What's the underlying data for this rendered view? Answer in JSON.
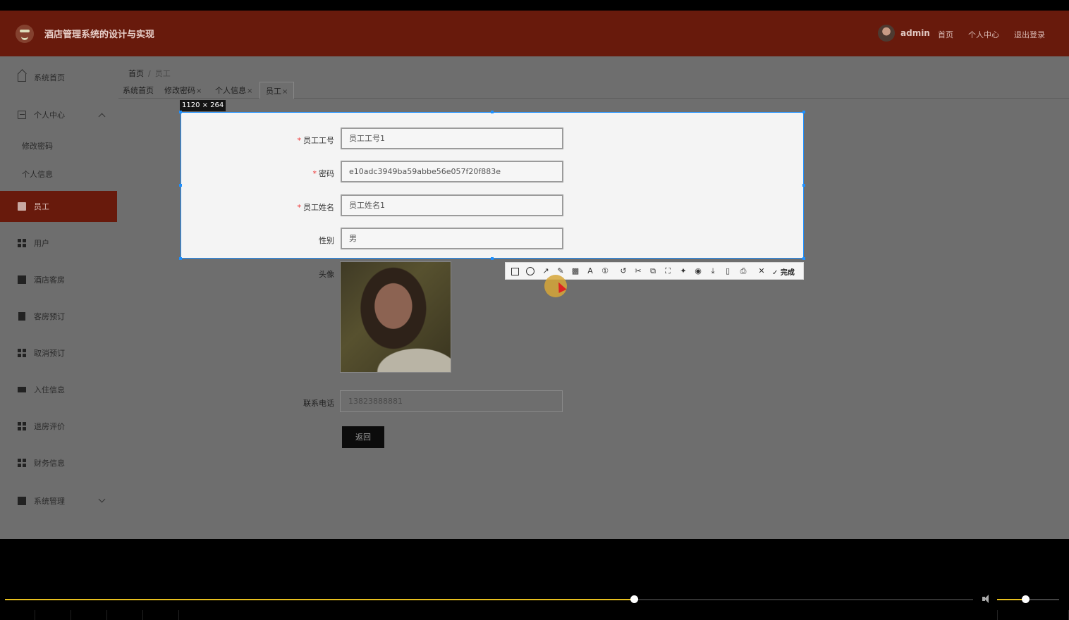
{
  "header": {
    "app_title": "酒店管理系统的设计与实现",
    "username": "admin",
    "links": [
      "首页",
      "个人中心",
      "退出登录"
    ]
  },
  "sidebar": {
    "items": [
      {
        "label": "系统首页",
        "icon": "home-icon"
      },
      {
        "label": "个人中心",
        "icon": "profile-card-icon",
        "expanded": true,
        "children": [
          "修改密码",
          "个人信息"
        ]
      },
      {
        "label": "员工",
        "icon": "briefcase-icon",
        "active": true
      },
      {
        "label": "用户",
        "icon": "grid-icon"
      },
      {
        "label": "酒店客房",
        "icon": "chart-icon"
      },
      {
        "label": "客房预订",
        "icon": "clipboard-icon"
      },
      {
        "label": "取消预订",
        "icon": "grid-icon"
      },
      {
        "label": "入住信息",
        "icon": "ticket-icon"
      },
      {
        "label": "退房评价",
        "icon": "grid-icon"
      },
      {
        "label": "财务信息",
        "icon": "grid-icon"
      },
      {
        "label": "系统管理",
        "icon": "library-icon",
        "expanded": false
      }
    ]
  },
  "breadcrumb": {
    "home": "首页",
    "separator": "/",
    "current": "员工"
  },
  "tabs": [
    {
      "label": "系统首页",
      "closable": false
    },
    {
      "label": "修改密码",
      "closable": true
    },
    {
      "label": "个人信息",
      "closable": true
    },
    {
      "label": "员工",
      "closable": true,
      "active": true
    }
  ],
  "tab_close": "×",
  "form": {
    "fields": [
      {
        "label": "员工工号",
        "required": true,
        "value": "员工工号1"
      },
      {
        "label": "密码",
        "required": true,
        "value": "e10adc3949ba59abbe56e057f20f883e"
      },
      {
        "label": "员工姓名",
        "required": true,
        "value": "员工姓名1"
      },
      {
        "label": "性别",
        "required": false,
        "value": "男"
      }
    ],
    "avatar_label": "头像",
    "phone_label": "联系电话",
    "phone_value": "13823888881",
    "return_button": "返回"
  },
  "screenshot_tool": {
    "size_label": "1120 × 264",
    "tools": [
      "rectangle-icon",
      "circle-icon",
      "arrow-icon",
      "pencil-icon",
      "mosaic-icon",
      "text-icon",
      "number-icon",
      "undo-icon",
      "cut-icon",
      "copy-icon",
      "fullscreen-icon",
      "pin-icon",
      "record-icon",
      "download-icon",
      "phone-icon",
      "bookmark-icon",
      "cancel-icon"
    ],
    "done_label": "完成",
    "selection_color": "#1e90ff"
  },
  "player": {
    "progress": 0.65,
    "volume": 0.45,
    "accent": "#e8c01e"
  },
  "colors": {
    "brand": "#681a0c",
    "overlay": "#6e6e6e"
  }
}
